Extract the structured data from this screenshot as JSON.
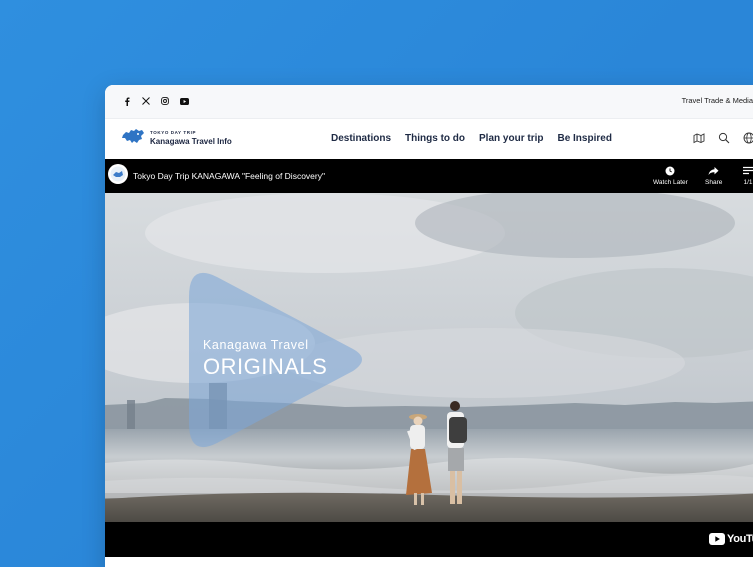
{
  "social": {
    "icons": [
      "facebook-icon",
      "x-icon",
      "instagram-icon",
      "youtube-icon"
    ]
  },
  "top_strip": {
    "trade_link": "Travel Trade & Media"
  },
  "logo": {
    "small": "TOKYO DAY TRIP",
    "big": "Kanagawa Travel Info"
  },
  "nav": {
    "items": [
      "Destinations",
      "Things to do",
      "Plan your trip",
      "Be Inspired"
    ],
    "icons": [
      "map-icon",
      "search-icon",
      "globe-icon"
    ]
  },
  "video": {
    "title": "Tokyo Day Trip KANAGAWA \"Feeling of Discovery\"",
    "watch_later": "Watch Later",
    "share": "Share",
    "playlist_count": "1/1",
    "overlay_line1": "Kanagawa Travel",
    "overlay_line2": "ORIGINALS",
    "brand": "YouTube"
  },
  "colors": {
    "background": "#2b88db",
    "nav_text": "#1e2a44",
    "play_overlay": "#8fb4e0"
  }
}
